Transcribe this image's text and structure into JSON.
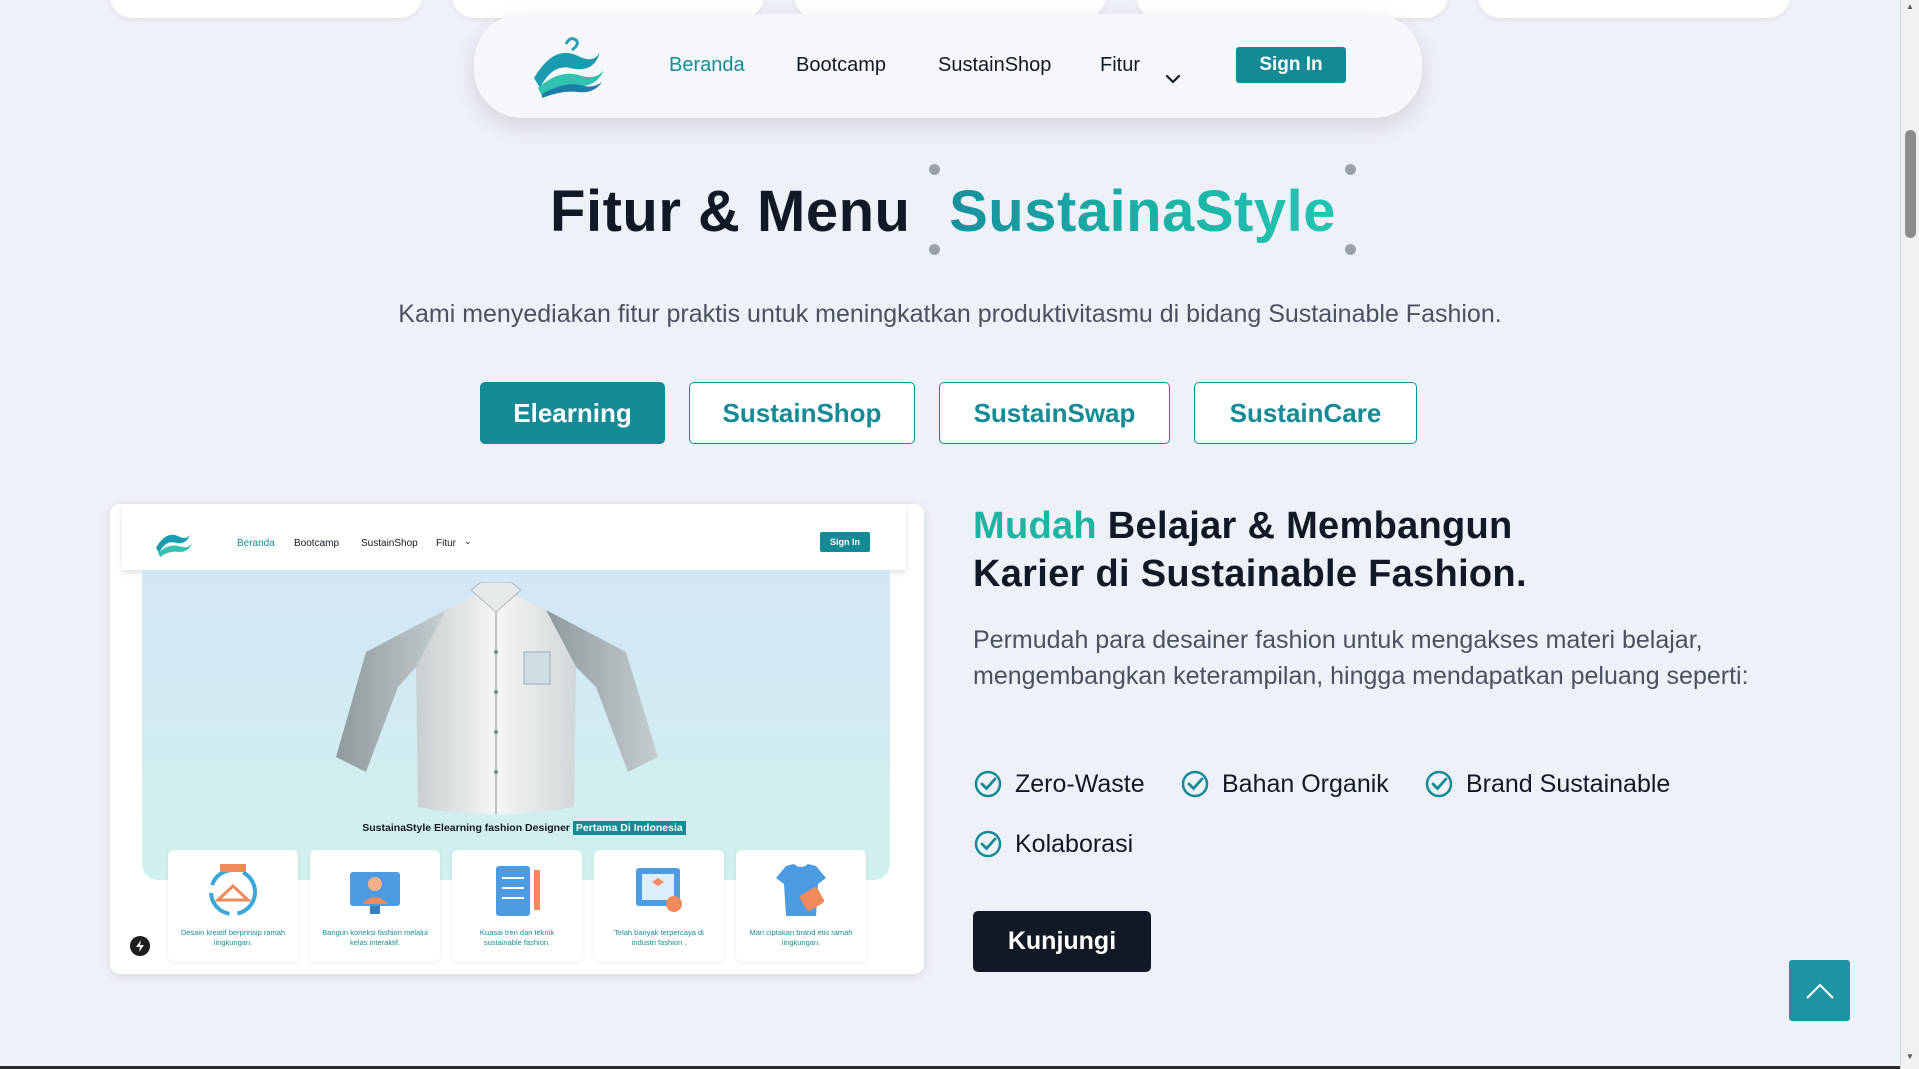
{
  "navbar": {
    "items": [
      {
        "label": "Beranda",
        "active": true
      },
      {
        "label": "Bootcamp",
        "active": false
      },
      {
        "label": "SustainShop",
        "active": false
      },
      {
        "label": "Fitur",
        "active": false
      }
    ],
    "signin_label": "Sign In",
    "logo_icon": "hanger-logo-icon",
    "dropdown_icon": "chevron-down-icon"
  },
  "heading": {
    "title_dark": "Fitur & Menu",
    "title_accent": "SustainaStyle",
    "subtitle": "Kami menyediakan fitur praktis untuk meningkatkan produktivitasmu di bidang Sustainable Fashion."
  },
  "tabs": [
    {
      "label": "Elearning",
      "active": true
    },
    {
      "label": "SustainShop",
      "active": false
    },
    {
      "label": "SustainSwap",
      "active": false
    },
    {
      "label": "SustainCare",
      "active": false
    }
  ],
  "preview": {
    "nav_items": [
      "Beranda",
      "Bootcamp",
      "SustainShop",
      "Fitur"
    ],
    "signin_label": "Sign In",
    "caption": "SustainaStyle Elearning fashion Designer",
    "caption_highlight": "Pertama Di Indonesia",
    "cards": [
      {
        "text": "Desain kreatif berprinsip ramah lingkungan.",
        "icon": "recycle-hanger-icon"
      },
      {
        "text": "Bangun koneksi fashion melalui kelas interaktif.",
        "icon": "online-class-icon"
      },
      {
        "text": "Kuasai tren dan teknik sustainable fashion.",
        "icon": "notebook-pencil-icon"
      },
      {
        "text": "Telah banyak terpercaya di industri fashion .",
        "icon": "certificate-icon"
      },
      {
        "text": "Mari ciptakan brand etis ramah lingkungan.",
        "icon": "tshirt-tag-icon"
      }
    ]
  },
  "feature": {
    "title_accent": "Mudah",
    "title_line1": " Belajar & Membangun",
    "title_line2": "Karier di Sustainable Fashion.",
    "description": "Permudah para desainer fashion untuk mengakses materi belajar, mengembangkan keterampilan, hingga mendapatkan peluang seperti:",
    "checks": [
      "Zero-Waste",
      "Bahan Organik",
      "Brand Sustainable",
      "Kolaborasi"
    ],
    "cta_label": "Kunjungi"
  },
  "colors": {
    "primary": "#138a96",
    "accent": "#1fb3a3",
    "dark": "#121826",
    "background": "#eef1f7"
  },
  "scroll_to_top_icon": "chevron-up-icon"
}
